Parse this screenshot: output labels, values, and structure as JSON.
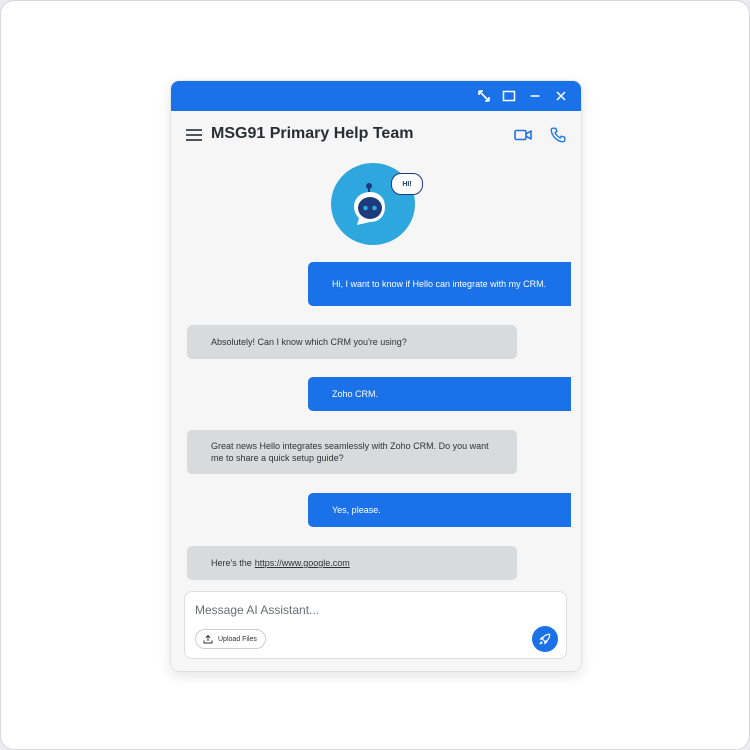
{
  "colors": {
    "accent": "#1b72e8",
    "incoming_bubble": "#d9dadc",
    "avatar_bg": "#2ea7df",
    "window_bg": "#f6f6f6"
  },
  "titlebar": {
    "controls": [
      {
        "icon": "expand-arrows-icon"
      },
      {
        "icon": "maximize-icon"
      },
      {
        "icon": "minimize-icon"
      },
      {
        "icon": "close-icon"
      }
    ]
  },
  "header": {
    "menu_icon": "hamburger-menu-icon",
    "title": "MSG91 Primary Help Team",
    "actions": [
      {
        "icon": "video-call-icon"
      },
      {
        "icon": "phone-call-icon"
      }
    ]
  },
  "avatar": {
    "bubble_text": "HI!"
  },
  "messages": [
    {
      "direction": "out",
      "text": "Hi, I want to know if Hello can integrate with my CRM."
    },
    {
      "direction": "in",
      "text": "Absolutely! Can I know which CRM you're using?"
    },
    {
      "direction": "out",
      "text": "Zoho CRM."
    },
    {
      "direction": "in",
      "text": "Great news  Hello integrates seamlessly with Zoho CRM. Do you want me to share a quick setup guide?"
    },
    {
      "direction": "out",
      "text": "Yes, please."
    },
    {
      "direction": "in",
      "text": "Here's the",
      "link": "https://www.google.com"
    }
  ],
  "composer": {
    "placeholder": "Message AI Assistant...",
    "value": "",
    "upload_label": "Upload Files",
    "send_icon": "rocket-send-icon"
  }
}
